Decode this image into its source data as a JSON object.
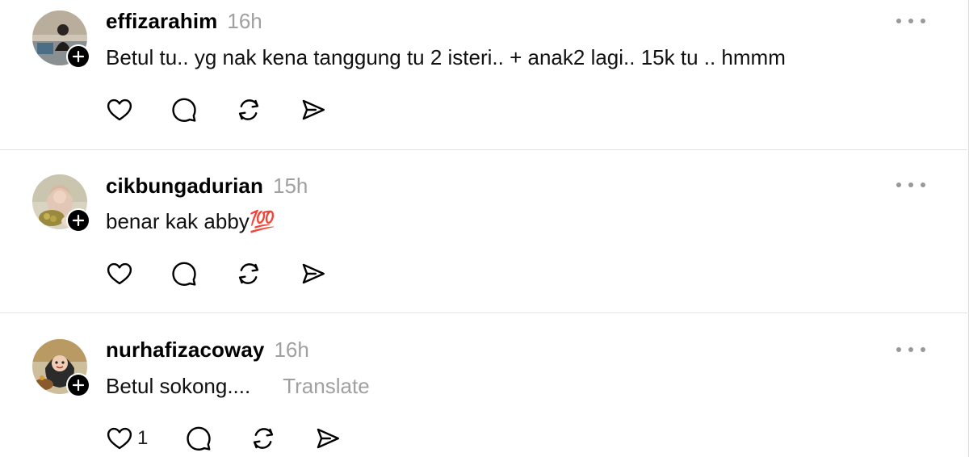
{
  "posts": [
    {
      "username": "effizarahim",
      "time": "16h",
      "text": "Betul tu.. yg nak kena tanggung tu 2 isteri.. + anak2 lagi.. 15k tu .. hmmm",
      "translate": "",
      "likes": ""
    },
    {
      "username": "cikbungadurian",
      "time": "15h",
      "text": "benar kak abby💯",
      "translate": "",
      "likes": ""
    },
    {
      "username": "nurhafizacoway",
      "time": "16h",
      "text": "Betul sokong....",
      "translate": "Translate",
      "likes": "1"
    }
  ],
  "colors": {
    "timestamp": "#a0a0a0",
    "divider": "#e3e3e3",
    "icon": "#000000"
  },
  "icons": [
    "heart-icon",
    "comment-icon",
    "repost-icon",
    "share-icon",
    "more-icon",
    "plus-icon"
  ]
}
